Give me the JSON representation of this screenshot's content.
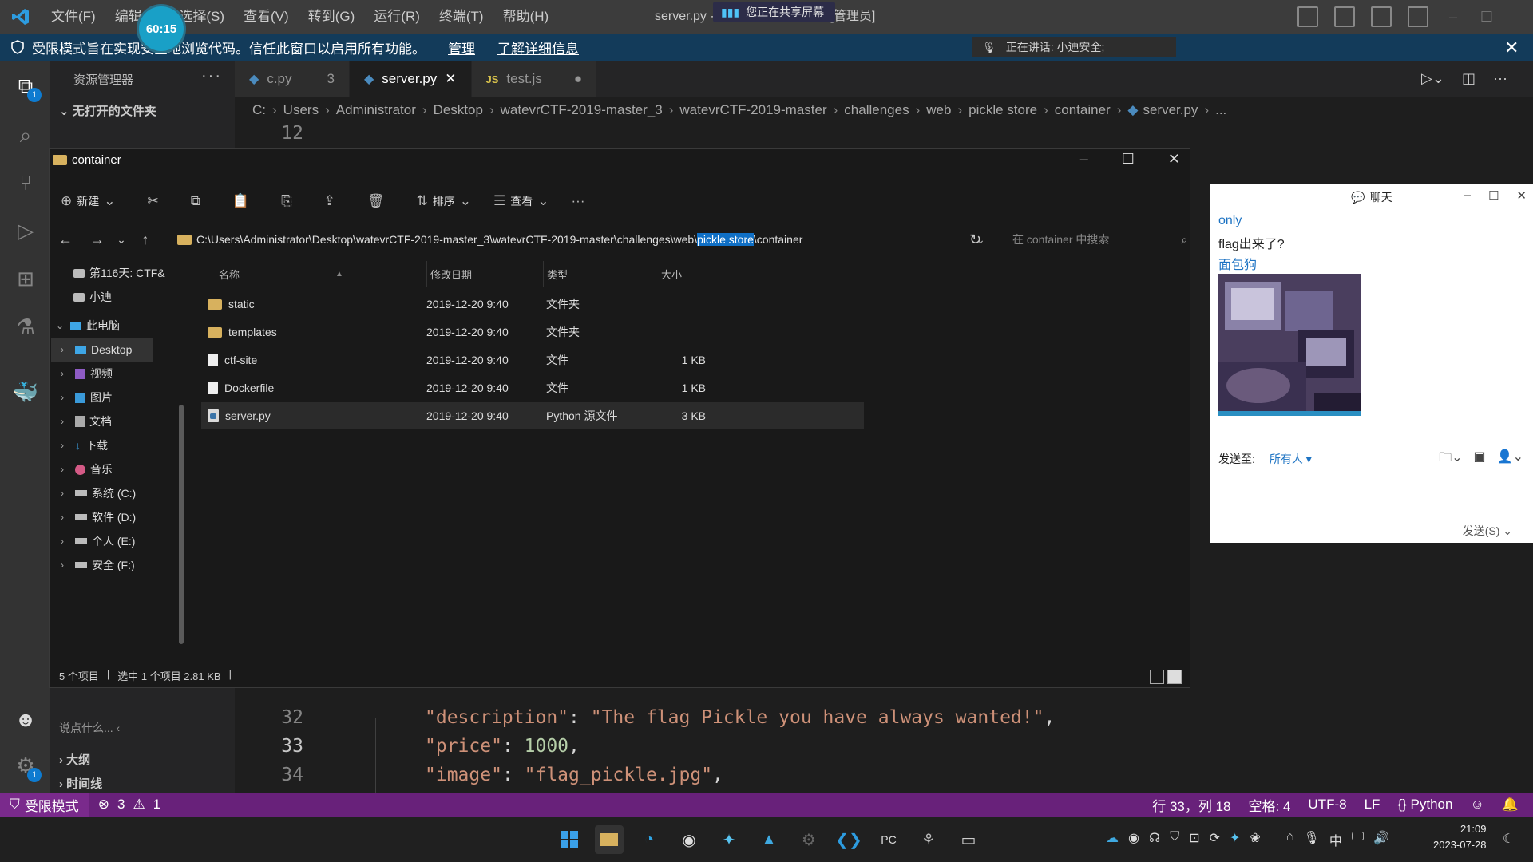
{
  "vscode": {
    "menu": [
      "文件(F)",
      "编辑(E)",
      "选择(S)",
      "查看(V)",
      "转到(G)",
      "运行(R)",
      "终端(T)",
      "帮助(H)"
    ],
    "title": "server.py - Visual Studio Code [管理员]",
    "share_pill": "您正在共享屏幕",
    "timer": "60:15",
    "banner": {
      "text": "受限模式旨在实现安全地浏览代码。信任此窗口以启用所有功能。",
      "manage": "管理",
      "learn_more": "了解详细信息"
    },
    "speaking": "正在讲话: 小迪安全;",
    "sidebar": {
      "header": "资源管理器",
      "no_folder": "无打开的文件夹",
      "chat_placeholder": "说点什么...",
      "outline": "大纲",
      "timeline": "时间线"
    },
    "tabs": [
      {
        "label": "c.py",
        "badge": "3",
        "kind": "py"
      },
      {
        "label": "server.py",
        "kind": "py",
        "active": true
      },
      {
        "label": "test.js",
        "kind": "js",
        "dirty": true
      }
    ],
    "breadcrumb": [
      "C:",
      "Users",
      "Administrator",
      "Desktop",
      "watevrCTF-2019-master_3",
      "watevrCTF-2019-master",
      "challenges",
      "web",
      "pickle store",
      "container",
      "server.py",
      "..."
    ],
    "code": {
      "top_line": "12",
      "lines": [
        {
          "num": "32",
          "key": "\"description\"",
          "value": "\"The flag Pickle you have always wanted!\"",
          "tail": ","
        },
        {
          "num": "33",
          "key": "\"price\"",
          "value": "1000",
          "tail": ","
        },
        {
          "num": "34",
          "key": "\"image\"",
          "value": "\"flag_pickle.jpg\"",
          "tail": ","
        }
      ]
    },
    "status": {
      "restricted": "受限模式",
      "errors": "3",
      "warnings": "1",
      "position": "行 33，列 18",
      "spaces": "空格: 4",
      "encoding": "UTF-8",
      "eol": "LF",
      "language": "Python"
    },
    "accent_color": "#68217a"
  },
  "explorer": {
    "title": "container",
    "toolbar": {
      "new": "新建",
      "sort": "排序",
      "view": "查看"
    },
    "address_before": "C:\\Users\\Administrator\\Desktop\\watevrCTF-2019-master_3\\watevrCTF-2019-master\\challenges\\web\\",
    "address_highlight": "pickle store",
    "address_after": "\\container",
    "search_placeholder": "在 container 中搜索",
    "nav": [
      {
        "label": "第116天: CTF&",
        "indent": 1
      },
      {
        "label": "小迪",
        "indent": 1
      },
      {
        "label": "此电脑",
        "indent": 0,
        "expanded": true
      },
      {
        "label": "Desktop",
        "indent": 1,
        "selected": true
      },
      {
        "label": "视频",
        "indent": 1
      },
      {
        "label": "图片",
        "indent": 1
      },
      {
        "label": "文档",
        "indent": 1
      },
      {
        "label": "下载",
        "indent": 1
      },
      {
        "label": "音乐",
        "indent": 1
      },
      {
        "label": "系统 (C:)",
        "indent": 1
      },
      {
        "label": "软件 (D:)",
        "indent": 1
      },
      {
        "label": "个人 (E:)",
        "indent": 1
      },
      {
        "label": "安全 (F:)",
        "indent": 1
      }
    ],
    "columns": [
      "名称",
      "修改日期",
      "类型",
      "大小"
    ],
    "files": [
      {
        "name": "static",
        "date": "2019-12-20 9:40",
        "type": "文件夹",
        "size": "",
        "icon": "folder"
      },
      {
        "name": "templates",
        "date": "2019-12-20 9:40",
        "type": "文件夹",
        "size": "",
        "icon": "folder"
      },
      {
        "name": "ctf-site",
        "date": "2019-12-20 9:40",
        "type": "文件",
        "size": "1 KB",
        "icon": "file"
      },
      {
        "name": "Dockerfile",
        "date": "2019-12-20 9:40",
        "type": "文件",
        "size": "1 KB",
        "icon": "file"
      },
      {
        "name": "server.py",
        "date": "2019-12-20 9:40",
        "type": "Python 源文件",
        "size": "3 KB",
        "icon": "py",
        "selected": true
      }
    ],
    "status_count": "5 个项目",
    "status_selected": "选中 1 个项目  2.81 KB"
  },
  "chat": {
    "title": "聊天",
    "messages": [
      {
        "sender": "only",
        "text": "flag出来了?"
      },
      {
        "sender": "面包狗",
        "text": ""
      }
    ],
    "send_to_label": "发送至:",
    "send_to_value": "所有人",
    "send_button": "发送(S)"
  },
  "taskbar": {
    "clock_time": "21:09",
    "clock_date": "2023-07-28",
    "ime": "中"
  }
}
